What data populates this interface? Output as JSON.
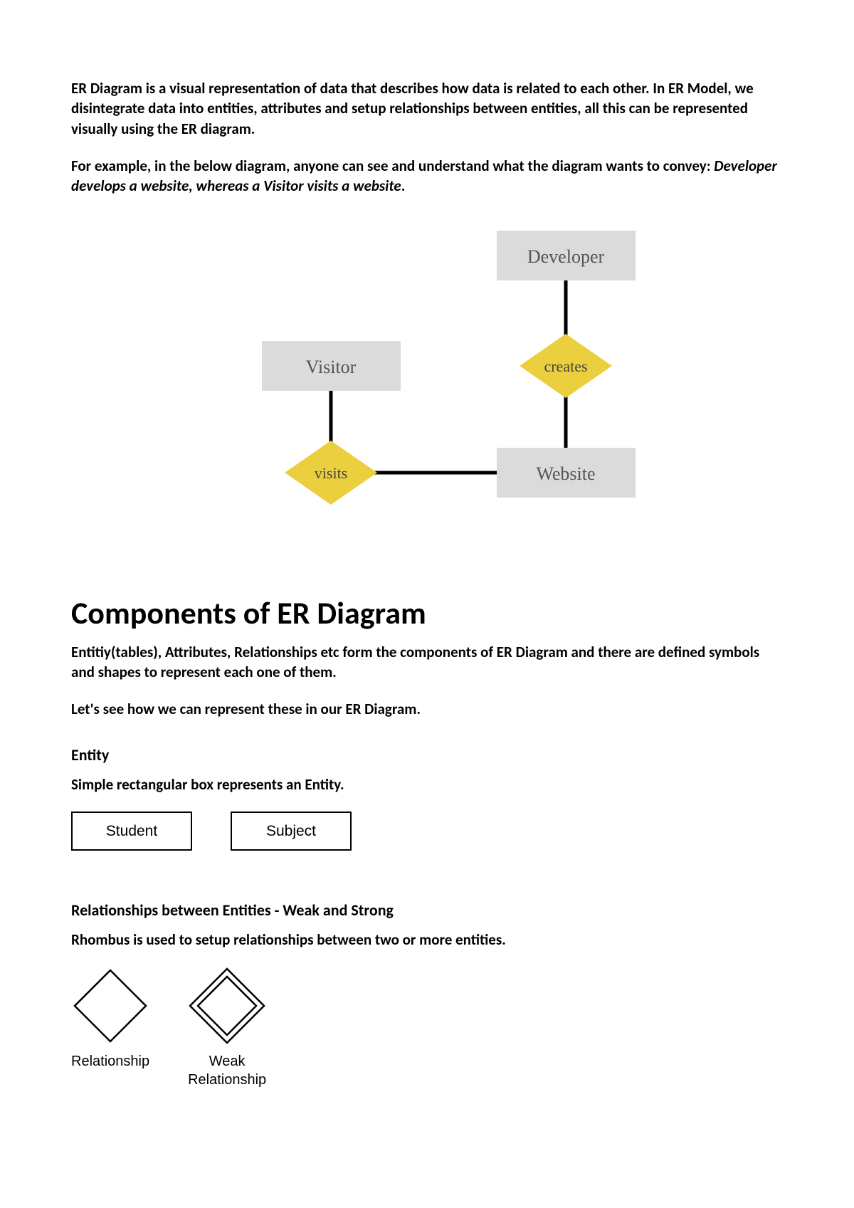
{
  "intro_para1": "ER Diagram is a visual representation of data that describes how data is related to each other. In ER Model, we disintegrate data into entities, attributes and setup relationships between entities, all this can be represented visually using the ER diagram.",
  "intro_para2_prefix": "For example, in the below diagram, anyone can see and understand what the diagram wants to convey: ",
  "intro_para2_italic": "Developer develops a website, whereas a Visitor visits a website",
  "intro_para2_suffix": ".",
  "er_diagram": {
    "developer": "Developer",
    "visitor": "Visitor",
    "website": "Website",
    "creates": "creates",
    "visits": "visits"
  },
  "components_title": "Components of ER Diagram",
  "components_para1": "Entitiy(tables), Attributes, Relationships etc form the components of ER Diagram and there are defined symbols and shapes to represent each one of them.",
  "components_para2": "Let's see how we can represent these in our ER Diagram.",
  "entity_heading": "Entity",
  "entity_para": "Simple rectangular box represents an Entity.",
  "entity_boxes": {
    "student": "Student",
    "subject": "Subject"
  },
  "relationships_heading": "Relationships between Entities - Weak and Strong",
  "relationships_para": "Rhombus is used to setup relationships between two or more entities.",
  "rel_labels": {
    "relationship": "Relationship",
    "weak": "Weak\nRelationship"
  }
}
